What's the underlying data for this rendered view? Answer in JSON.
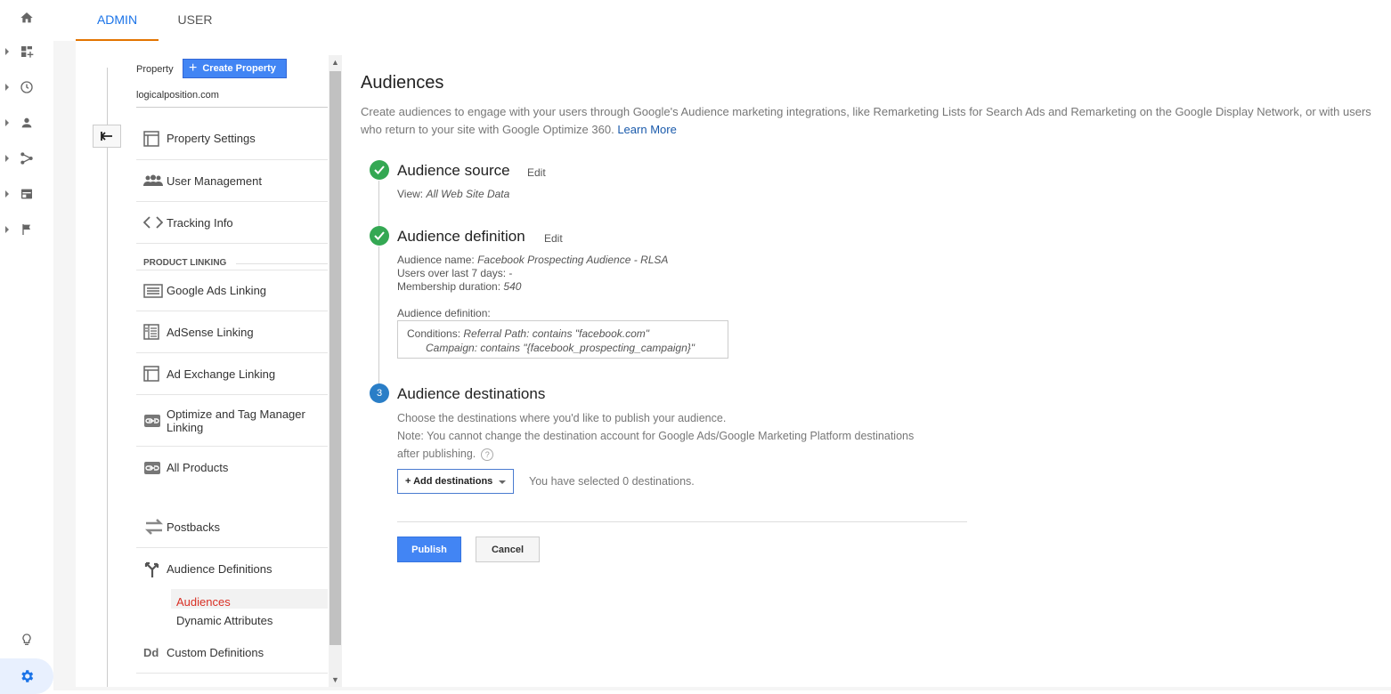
{
  "rail": {
    "items": [
      "home-icon",
      "customization-icon",
      "realtime-icon",
      "audience-icon",
      "acquisition-icon",
      "behavior-icon",
      "conversions-icon"
    ],
    "bottom": [
      "discover-icon",
      "admin-gear-icon"
    ]
  },
  "tabs": {
    "admin": "ADMIN",
    "user": "USER"
  },
  "nav": {
    "property_label": "Property",
    "create_property": "Create Property",
    "property_name": "logicalposition.com",
    "items": {
      "property_settings": "Property Settings",
      "user_management": "User Management",
      "tracking_info": "Tracking Info",
      "google_ads_linking": "Google Ads Linking",
      "adsense_linking": "AdSense Linking",
      "ad_exchange_linking": "Ad Exchange Linking",
      "optimize_tag_manager_1": "Optimize and Tag Manager",
      "optimize_tag_manager_2": "Linking",
      "all_products": "All Products",
      "postbacks": "Postbacks",
      "audience_definitions": "Audience Definitions",
      "custom_definitions": "Custom Definitions"
    },
    "section_product_linking": "PRODUCT LINKING",
    "sub": {
      "audiences": "Audiences",
      "dynamic_attributes": "Dynamic Attributes"
    },
    "custom_def_icon_text": "Dd"
  },
  "main": {
    "title": "Audiences",
    "desc_line": "Create audiences to engage with your users through Google's Audience marketing integrations, like Remarketing Lists for Search Ads and Remarketing on the Google Display Network, or with users who return to your site with Google Optimize 360.",
    "learn_more": "Learn More",
    "step1": {
      "title": "Audience source",
      "edit": "Edit",
      "view_label": "View:",
      "view_value": "All Web Site Data"
    },
    "step2": {
      "title": "Audience definition",
      "edit": "Edit",
      "name_label": "Audience name:",
      "name_value": "Facebook Prospecting Audience - RLSA",
      "users_label": "Users over last 7 days:",
      "users_value": "-",
      "duration_label": "Membership duration:",
      "duration_value": "540",
      "def_label": "Audience definition:",
      "cond_label": "Conditions:",
      "cond_1": "Referral Path: contains \"facebook.com\"",
      "cond_2": "Campaign: contains \"{facebook_prospecting_campaign}\""
    },
    "step3": {
      "number": "3",
      "title": "Audience destinations",
      "choose": "Choose the destinations where you'd like to publish your audience.",
      "note_1": "Note: You cannot change the destination account for Google Ads/Google Marketing Platform destinations",
      "note_2": "after publishing.",
      "help": "?",
      "add_destinations": "+ Add destinations",
      "selected": "You have selected 0 destinations."
    },
    "publish": "Publish",
    "cancel": "Cancel"
  },
  "colors": {
    "accent": "#1a73e8",
    "tab_underline": "#e37400",
    "check": "#34a853",
    "step_num": "#2a7ec7",
    "selected_sub": "#d93025"
  }
}
